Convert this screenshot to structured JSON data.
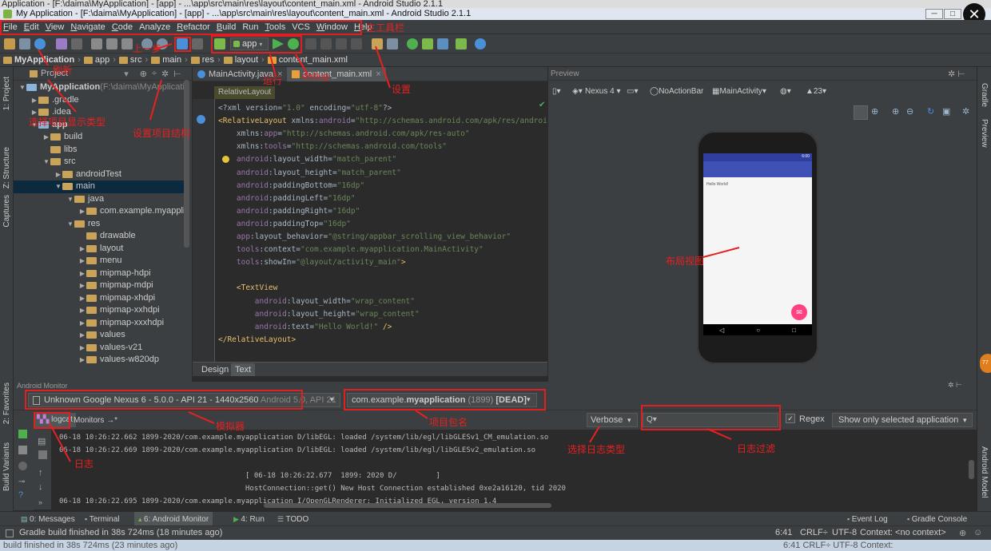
{
  "background_window": {
    "title": "Application - [F:\\daima\\MyApplication] - [app] - ...\\app\\src\\main\\res\\layout\\content_main.xml - Android Studio 2.1.1"
  },
  "window": {
    "title": "My Application - [F:\\daima\\MyApplication] - [app] - ...\\app\\src\\main\\res\\layout\\content_main.xml - Android Studio 2.1.1",
    "minimize": "─",
    "maximize": "□",
    "close": "✕",
    "overlay_close": "✕"
  },
  "menu": [
    {
      "u": "F",
      "rest": "ile"
    },
    {
      "u": "E",
      "rest": "dit"
    },
    {
      "u": "V",
      "rest": "iew"
    },
    {
      "u": "N",
      "rest": "avigate"
    },
    {
      "u": "C",
      "rest": "ode"
    },
    {
      "u": "",
      "rest": "Analyze"
    },
    {
      "u": "R",
      "rest": "efactor"
    },
    {
      "u": "B",
      "rest": "uild"
    },
    {
      "u": "",
      "rest": "Run"
    },
    {
      "u": "T",
      "rest": "ools"
    },
    {
      "u": "",
      "rest": "VCS"
    },
    {
      "u": "W",
      "rest": "indow"
    },
    {
      "u": "H",
      "rest": "elp"
    }
  ],
  "toolbar": {
    "run_config": "app"
  },
  "breadcrumb": [
    "MyApplication",
    "app",
    "src",
    "main",
    "res",
    "layout",
    "content_main.xml"
  ],
  "project": {
    "header": "Project",
    "tree": [
      {
        "label": "MyApplication",
        "suffix": " (F:\\daima\\MyApplication)",
        "depth": 0,
        "open": true,
        "bold": true
      },
      {
        "label": ".gradle",
        "depth": 1,
        "open": false
      },
      {
        "label": ".idea",
        "depth": 1,
        "open": false
      },
      {
        "label": "app",
        "depth": 1,
        "open": true,
        "bold": true
      },
      {
        "label": "build",
        "depth": 2,
        "open": false
      },
      {
        "label": "libs",
        "depth": 2,
        "open": null
      },
      {
        "label": "src",
        "depth": 2,
        "open": true
      },
      {
        "label": "androidTest",
        "depth": 3,
        "open": false
      },
      {
        "label": "main",
        "depth": 3,
        "open": true,
        "selected": true
      },
      {
        "label": "java",
        "depth": 4,
        "open": true
      },
      {
        "label": "com.example.myappli",
        "depth": 5,
        "open": false
      },
      {
        "label": "res",
        "depth": 4,
        "open": true
      },
      {
        "label": "drawable",
        "depth": 5,
        "open": null
      },
      {
        "label": "layout",
        "depth": 5,
        "open": false
      },
      {
        "label": "menu",
        "depth": 5,
        "open": false
      },
      {
        "label": "mipmap-hdpi",
        "depth": 5,
        "open": false
      },
      {
        "label": "mipmap-mdpi",
        "depth": 5,
        "open": false
      },
      {
        "label": "mipmap-xhdpi",
        "depth": 5,
        "open": false
      },
      {
        "label": "mipmap-xxhdpi",
        "depth": 5,
        "open": false
      },
      {
        "label": "mipmap-xxxhdpi",
        "depth": 5,
        "open": false
      },
      {
        "label": "values",
        "depth": 5,
        "open": false
      },
      {
        "label": "values-v21",
        "depth": 5,
        "open": false
      },
      {
        "label": "values-w820dp",
        "depth": 5,
        "open": false
      }
    ]
  },
  "editor": {
    "tabs": [
      "MainActivity.java",
      "content_main.xml"
    ],
    "breadcrumb": "RelativeLayout",
    "design_tabs": [
      "Design",
      "Text"
    ],
    "lines": [
      [
        [
          "pl",
          "<?xml version="
        ],
        [
          "st",
          "\"1.0\""
        ],
        [
          "pl",
          " encoding="
        ],
        [
          "st",
          "\"utf-8\""
        ],
        [
          "pl",
          "?>"
        ]
      ],
      [
        [
          "kw",
          "<RelativeLayout "
        ],
        [
          "pl",
          "xmlns:"
        ],
        [
          "at",
          "android"
        ],
        [
          "pl",
          "="
        ],
        [
          "st",
          "\"http://schemas.android.com/apk/res/android\""
        ]
      ],
      [
        [
          "pl",
          "    xmlns:"
        ],
        [
          "at",
          "app"
        ],
        [
          "pl",
          "="
        ],
        [
          "st",
          "\"http://schemas.android.com/apk/res-auto\""
        ]
      ],
      [
        [
          "pl",
          "    xmlns:"
        ],
        [
          "at",
          "tools"
        ],
        [
          "pl",
          "="
        ],
        [
          "st",
          "\"http://schemas.android.com/tools\""
        ]
      ],
      [
        [
          "at",
          "    android"
        ],
        [
          "pl",
          ":layout_width="
        ],
        [
          "st",
          "\"match_parent\""
        ]
      ],
      [
        [
          "at",
          "    android"
        ],
        [
          "pl",
          ":layout_height="
        ],
        [
          "st",
          "\"match_parent\""
        ]
      ],
      [
        [
          "at",
          "    android"
        ],
        [
          "pl",
          ":paddingBottom="
        ],
        [
          "st",
          "\"16dp\""
        ]
      ],
      [
        [
          "at",
          "    android"
        ],
        [
          "pl",
          ":paddingLeft="
        ],
        [
          "st",
          "\"16dp\""
        ]
      ],
      [
        [
          "at",
          "    android"
        ],
        [
          "pl",
          ":paddingRight="
        ],
        [
          "st",
          "\"16dp\""
        ]
      ],
      [
        [
          "at",
          "    android"
        ],
        [
          "pl",
          ":paddingTop="
        ],
        [
          "st",
          "\"16dp\""
        ]
      ],
      [
        [
          "at",
          "    app"
        ],
        [
          "pl",
          ":layout_behavior="
        ],
        [
          "st",
          "\"@string/appbar_scrolling_view_behavior\""
        ]
      ],
      [
        [
          "at",
          "    tools"
        ],
        [
          "pl",
          ":context="
        ],
        [
          "st",
          "\"com.example.myapplication.MainActivity\""
        ]
      ],
      [
        [
          "at",
          "    tools"
        ],
        [
          "pl",
          ":showIn="
        ],
        [
          "st",
          "\"@layout/activity_main\""
        ],
        [
          "kw",
          ">"
        ]
      ],
      [
        [
          "pl",
          ""
        ]
      ],
      [
        [
          "kw",
          "    <TextView"
        ]
      ],
      [
        [
          "at",
          "        android"
        ],
        [
          "pl",
          ":layout_width="
        ],
        [
          "st",
          "\"wrap_content\""
        ]
      ],
      [
        [
          "at",
          "        android"
        ],
        [
          "pl",
          ":layout_height="
        ],
        [
          "st",
          "\"wrap_content\""
        ]
      ],
      [
        [
          "at",
          "        android"
        ],
        [
          "pl",
          ":text="
        ],
        [
          "st",
          "\"Hello World!\""
        ],
        [
          "kw",
          " />"
        ]
      ],
      [
        [
          "kw",
          "</RelativeLayout>"
        ]
      ]
    ]
  },
  "preview": {
    "header": "Preview",
    "device": "Nexus 4",
    "theme": "NoActionBar",
    "activity": "MainActivity",
    "api": "23",
    "phone_time": "6:00",
    "hello": "Hello World!",
    "fab_icon": "✉"
  },
  "monitor": {
    "header": "Android Monitor",
    "device": "Unknown Google Nexus 6 - 5.0.0 - API 21 - 1440x2560",
    "device_suffix": " Android 5.0, API 21",
    "process_prefix": "com.example.",
    "process_bold": "myapplication",
    "process_suffix": " (1899) ",
    "process_state": "[DEAD]",
    "tabs": [
      "logcat",
      "Monitors"
    ],
    "level": "Verbose",
    "search_icon": "Q▾",
    "regex": "Regex",
    "filter": "Show only selected application",
    "logs": [
      "06-18 10:26:22.662 1899-2020/com.example.myapplication D/libEGL: loaded /system/lib/egl/libGLESv1_CM_emulation.so",
      "06-18 10:26:22.669 1899-2020/com.example.myapplication D/libEGL: loaded /system/lib/egl/libGLESv2_emulation.so",
      "",
      "                                           [ 06-18 10:26:22.677  1899: 2020 D/         ]",
      "                                           HostConnection::get() New Host Connection established 0xe2a16120, tid 2020",
      "06-18 10:26:22.695 1899-2020/com.example.myapplication I/OpenGLRenderer: Initialized EGL, version 1.4"
    ]
  },
  "bottom_tabs": {
    "messages": "0: Messages",
    "terminal": "Terminal",
    "monitor": "6: Android Monitor",
    "run": "4: Run",
    "todo": "TODO",
    "event_log": "Event Log",
    "gradle_console": "Gradle Console"
  },
  "status": {
    "message": "Gradle build finished in 38s 724ms (18 minutes ago)",
    "position": "6:41",
    "line_sep": "CRLF÷",
    "encoding": "UTF-8",
    "context": "Context: <no context>"
  },
  "taskbar": {
    "text": "build finished in 38s 724ms (23 minutes ago)",
    "right": "6:41   CRLF÷   UTF-8   Context:"
  },
  "side_tabs": {
    "project": "1: Project",
    "structure": "Z: Structure",
    "captures": "Captures",
    "favorites": "2: Favorites",
    "build_variants": "Build Variants",
    "gradle": "Gradle",
    "preview": "Preview",
    "android_model": "Android Model"
  },
  "annotations": {
    "main_toolbar": "主工具栏",
    "refresh": "刷新",
    "prev_step": "上一步",
    "run": "运行",
    "debug": "debug",
    "settings": "设置",
    "project_display_type": "选择项目显示类型",
    "project_structure": "设置项目结构",
    "layout_view": "布局视图",
    "emulator": "模拟器",
    "package_name": "项目包名",
    "log_level": "选择日志类型",
    "log_filter": "日志过滤",
    "log": "日志"
  },
  "orange_badge": "77"
}
